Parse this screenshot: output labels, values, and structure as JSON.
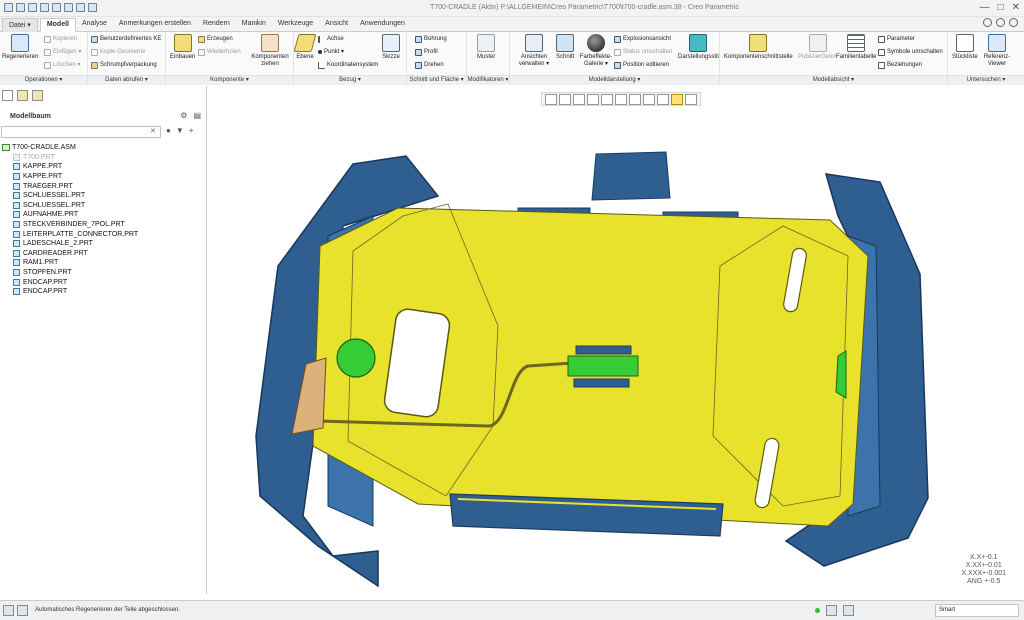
{
  "title": "T700-CRADLE (Aktiv) P:\\ALLGEMEIN\\Creo Parametric\\T700\\t700-cradle.asm.38 - Creo Parametric",
  "tabs": [
    {
      "label": "Datei ▾"
    },
    {
      "label": "Modell"
    },
    {
      "label": "Analyse"
    },
    {
      "label": "Anmerkungen erstellen"
    },
    {
      "label": "Rendern"
    },
    {
      "label": "Manikin"
    },
    {
      "label": "Werkzeuge"
    },
    {
      "label": "Ansicht"
    },
    {
      "label": "Anwendungen"
    }
  ],
  "ribbon": {
    "operationen": {
      "label": "Operationen ▾",
      "regenerieren": "Regenerieren",
      "kopieren": "Kopieren",
      "einfuegen": "Einfügen ▾",
      "loeschen": "Löschen ▾"
    },
    "daten": {
      "label": "Daten abrufen ▾",
      "benutzer": "Benutzerdefiniertes KE",
      "kopie": "Kopie-Geometrie",
      "schrumpf": "Schrumpfverpackung"
    },
    "komponente": {
      "label": "Komponente ▾",
      "einbauen": "Einbauen",
      "erzeugen": "Erzeugen",
      "wiederholen": "Wiederholen",
      "ziehen": "Komponenten ziehen"
    },
    "bezug": {
      "label": "Bezug ▾",
      "ebene": "Ebene",
      "achse": "Achse",
      "punkt": "Punkt ▾",
      "koord": "Koordinatensystem",
      "skizze": "Skizze"
    },
    "schnitt": {
      "label": "Schnitt und Fläche ▾",
      "bohrung": "Bohrung",
      "profil": "Profil",
      "drehen": "Drehen"
    },
    "modifikatoren": {
      "label": "Modifikatoren ▾",
      "muster": "Muster"
    },
    "modelldarstellung": {
      "label": "Modelldarstellung ▾",
      "ansichten": "Ansichten verwalten ▾",
      "schnitt": "Schnitt",
      "farbeffekte": "Farbeffekte-Galerie ▾",
      "explosion": "Explosionsansicht",
      "status": "Status umschalten",
      "position": "Position editieren",
      "darstellung": "Darstellungsstil"
    },
    "modellabsicht": {
      "label": "Modellabsicht ▾",
      "schnittstelle": "Komponentenschnittstelle",
      "publizieren": "PublizierGeom",
      "familie": "Familientabelle",
      "parameter": "Parameter",
      "symbole": "Symbole umschalten",
      "beziehungen": "Beziehungen"
    },
    "untersuchen": {
      "label": "Untersuchen ▾",
      "stueckliste": "Stückliste",
      "referenz": "Referenz-Viewer"
    }
  },
  "model_tree": {
    "title": "Modellbaum",
    "search_placeholder": "",
    "root": "T700-CRADLE.ASM",
    "items": [
      {
        "label": "T700.PRT",
        "dim": true
      },
      {
        "label": "KAPPE.PRT"
      },
      {
        "label": "KAPPE.PRT"
      },
      {
        "label": "TRAEGER.PRT"
      },
      {
        "label": "SCHLUESSEL.PRT"
      },
      {
        "label": "SCHLUESSEL.PRT"
      },
      {
        "label": "AUFNAHME.PRT"
      },
      {
        "label": "STECKVERBINDER_7POL.PRT"
      },
      {
        "label": "LEITERPLATTE_CONNECTOR.PRT"
      },
      {
        "label": "LADESCHALE_2.PRT"
      },
      {
        "label": "CARDREADER.PRT"
      },
      {
        "label": "RAM1.PRT"
      },
      {
        "label": "STOPFEN.PRT"
      },
      {
        "label": "ENDCAP.PRT"
      },
      {
        "label": "ENDCAP.PRT"
      }
    ]
  },
  "tolerance": [
    "X.X+-0.1",
    "X.XX+-0.01",
    "X.XXX+-0.001",
    "ANG +-0.5"
  ],
  "status": {
    "message": "Automatisches Regenerieren der Teile abgeschlossen.",
    "filter": "Smart"
  },
  "colors": {
    "housing": "#2f5f91",
    "plate": "#e8e22c",
    "green": "#35cc35",
    "tan": "#dcb27a"
  }
}
